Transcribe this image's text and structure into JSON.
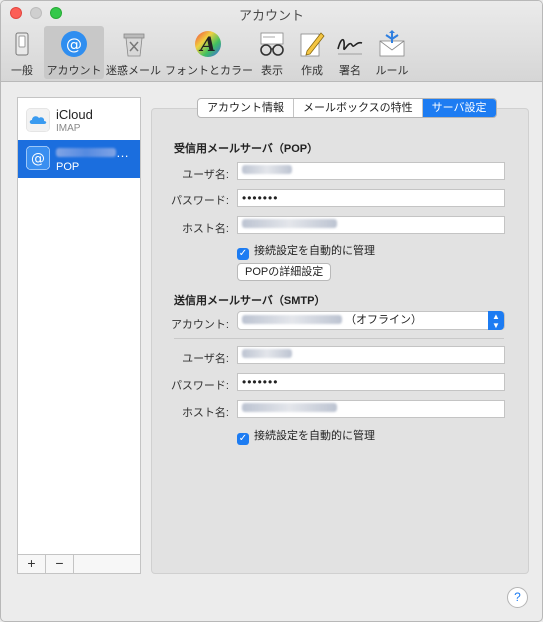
{
  "window": {
    "title": "アカウント"
  },
  "toolbar": {
    "items": [
      {
        "label": "一般"
      },
      {
        "label": "アカウント"
      },
      {
        "label": "迷惑メール"
      },
      {
        "label": "フォントとカラー"
      },
      {
        "label": "表示"
      },
      {
        "label": "作成"
      },
      {
        "label": "署名"
      },
      {
        "label": "ルール"
      }
    ]
  },
  "accounts": [
    {
      "name": "iCloud",
      "type": "IMAP"
    },
    {
      "name": "…",
      "type": "POP"
    }
  ],
  "list_footer": {
    "add": "+",
    "remove": "−"
  },
  "tabs": [
    {
      "label": "アカウント情報"
    },
    {
      "label": "メールボックスの特性"
    },
    {
      "label": "サーバ設定"
    }
  ],
  "incoming": {
    "title": "受信用メールサーバ（POP）",
    "user_label": "ユーザ名:",
    "password_label": "パスワード:",
    "password_value": "•••••••",
    "host_label": "ホスト名:",
    "auto_manage_label": "接続設定を自動的に管理",
    "details_button": "POPの詳細設定"
  },
  "outgoing": {
    "title": "送信用メールサーバ（SMTP）",
    "account_label": "アカウント:",
    "account_status": "（オフライン）",
    "user_label": "ユーザ名:",
    "password_label": "パスワード:",
    "password_value": "•••••••",
    "host_label": "ホスト名:",
    "auto_manage_label": "接続設定を自動的に管理"
  },
  "help": {
    "label": "?"
  },
  "colors": {
    "accent": "#1d7cf2",
    "selection": "#1b6ede"
  }
}
